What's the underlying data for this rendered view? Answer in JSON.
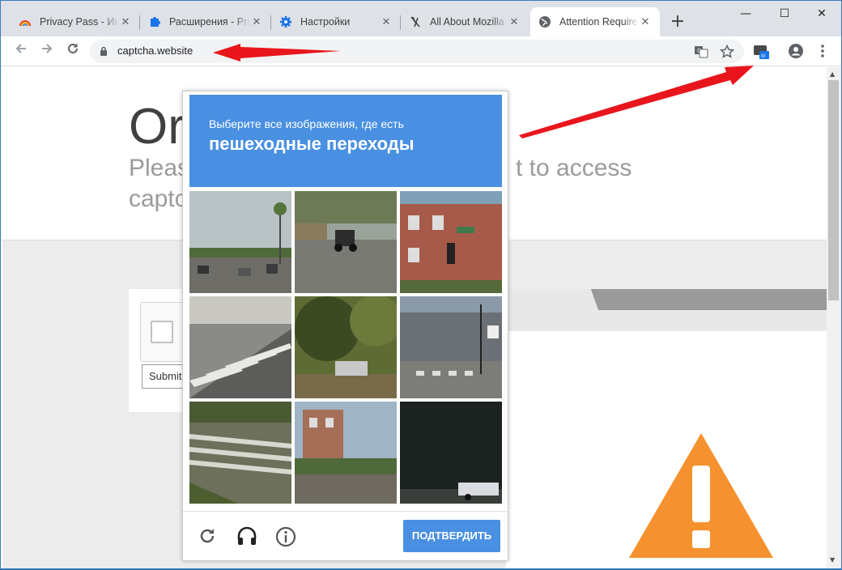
{
  "browser": {
    "tabs": [
      {
        "label": "Privacy Pass - Инт",
        "icon": "rainbow-icon"
      },
      {
        "label": "Расширения - Pri",
        "icon": "puzzle-icon"
      },
      {
        "label": "Настройки",
        "icon": "gear-icon"
      },
      {
        "label": "All About Mozilla",
        "icon": "mozilla-icon"
      },
      {
        "label": "Attention Require",
        "icon": "globe-icon"
      }
    ],
    "new_tab": "+",
    "address": "captcha.website",
    "window_controls": {
      "minimize": "—",
      "maximize": "☐",
      "close": "✕"
    }
  },
  "page": {
    "heading": "Or",
    "line1_left": "Pleas",
    "line1_right": "t to access",
    "line2_left": "captc",
    "submit_label": "Submit"
  },
  "captcha": {
    "instruction": "Выберите все изображения, где есть",
    "target": "пешеходные переходы",
    "verify_label": "ПОДТВЕРДИТЬ",
    "accent_color": "#4a90e2"
  },
  "colors": {
    "annotation_arrow": "#e8161c",
    "warning": "#f5922f"
  }
}
